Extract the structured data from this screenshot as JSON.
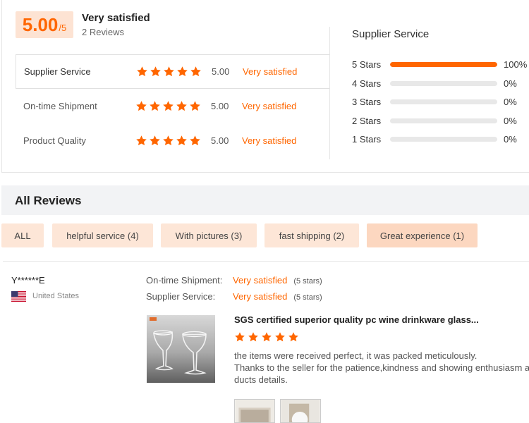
{
  "summary": {
    "score": "5.00",
    "score_suffix": "/5",
    "overall_label": "Very satisfied",
    "reviews_count": "2 Reviews",
    "metrics": [
      {
        "name": "Supplier Service",
        "score": "5.00",
        "text": "Very satisfied",
        "stars": 5,
        "active": true
      },
      {
        "name": "On-time Shipment",
        "score": "5.00",
        "text": "Very satisfied",
        "stars": 5,
        "active": false
      },
      {
        "name": "Product Quality",
        "score": "5.00",
        "text": "Very satisfied",
        "stars": 5,
        "active": false
      }
    ]
  },
  "distribution": {
    "title": "Supplier Service",
    "rows": [
      {
        "label": "5 Stars",
        "percent": "100%",
        "fill": 1.0
      },
      {
        "label": "4 Stars",
        "percent": "0%",
        "fill": 0
      },
      {
        "label": "3 Stars",
        "percent": "0%",
        "fill": 0
      },
      {
        "label": "2 Stars",
        "percent": "0%",
        "fill": 0
      },
      {
        "label": "1 Stars",
        "percent": "0%",
        "fill": 0
      }
    ]
  },
  "all_reviews": {
    "title": "All Reviews",
    "filters": [
      {
        "label": "ALL",
        "selected": false
      },
      {
        "label": "helpful service (4)",
        "selected": false
      },
      {
        "label": "With pictures (3)",
        "selected": false
      },
      {
        "label": "fast shipping (2)",
        "selected": false
      },
      {
        "label": "Great experience (1)",
        "selected": true
      }
    ]
  },
  "review": {
    "username": "Y******E",
    "country": "United States",
    "flag_icon": "us-flag-icon",
    "metrics": [
      {
        "name": "On-time Shipment:",
        "value": "Very satisfied",
        "stars": "(5 stars)"
      },
      {
        "name": "Supplier Service:",
        "value": "Very satisfied",
        "stars": "(5 stars)"
      }
    ],
    "product_title": "SGS certified superior quality pc wine drinkware glass...",
    "rating": 5,
    "text_lines": [
      "the items were received perfect, it was packed meticulously.",
      "Thanks to the seller for the patience,kindness and showing enthusiasm about the pro",
      "ducts details."
    ]
  },
  "colors": {
    "accent": "#ff6600",
    "badge_bg": "#fde3d3",
    "chip_bg": "#fde6d7",
    "header_bg": "#f2f3f5"
  }
}
